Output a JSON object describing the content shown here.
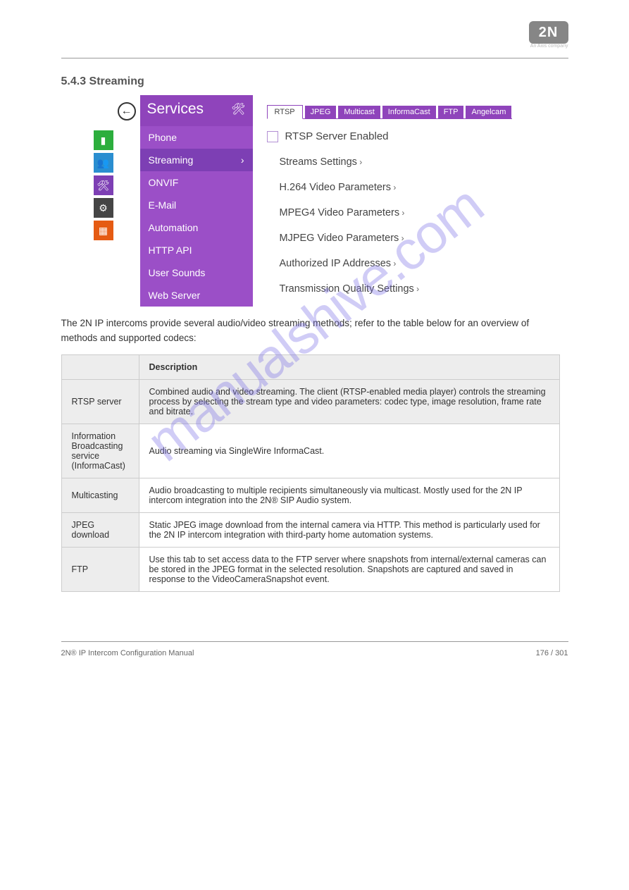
{
  "brand": {
    "logo_text": "2N",
    "sub_text": "An Axis company"
  },
  "section_title": "5.4.3 Streaming",
  "watermark": "manualshive.com",
  "ui": {
    "side_title": "Services",
    "gear_icon_name": "tools-icon",
    "side_icons": [
      {
        "name": "status-icon",
        "glyph": "▮",
        "cls": "ic-green"
      },
      {
        "name": "directory-icon",
        "glyph": "👥",
        "cls": "ic-blue"
      },
      {
        "name": "services-icon",
        "glyph": "🛠",
        "cls": "ic-purple"
      },
      {
        "name": "hardware-icon",
        "glyph": "⚙",
        "cls": "ic-dark"
      },
      {
        "name": "system-icon",
        "glyph": "▦",
        "cls": "ic-orange"
      }
    ],
    "side_items": [
      {
        "label": "Phone",
        "active": false
      },
      {
        "label": "Streaming",
        "active": true
      },
      {
        "label": "ONVIF",
        "active": false
      },
      {
        "label": "E-Mail",
        "active": false
      },
      {
        "label": "Automation",
        "active": false
      },
      {
        "label": "HTTP API",
        "active": false
      },
      {
        "label": "User Sounds",
        "active": false
      },
      {
        "label": "Web Server",
        "active": false
      }
    ],
    "tabs": [
      {
        "label": "RTSP",
        "active": true
      },
      {
        "label": "JPEG",
        "active": false
      },
      {
        "label": "Multicast",
        "active": false
      },
      {
        "label": "InformaCast",
        "active": false
      },
      {
        "label": "FTP",
        "active": false
      },
      {
        "label": "Angelcam",
        "active": false
      }
    ],
    "checkbox_label": "RTSP Server Enabled",
    "sub_links": [
      "Streams Settings",
      "H.264 Video Parameters",
      "MPEG4 Video Parameters",
      "MJPEG Video Parameters",
      "Authorized IP Addresses",
      "Transmission Quality Settings"
    ]
  },
  "intro": "The 2N IP intercoms provide several audio/video streaming methods; refer to the table below for an overview of methods and supported codecs:",
  "table": {
    "headers": [
      "",
      "Description"
    ],
    "rows": [
      [
        "RTSP server",
        "Combined audio and video streaming. The client (RTSP-enabled media player) controls the streaming process by selecting the stream type and video parameters: codec type, image resolution, frame rate and bitrate."
      ],
      [
        "Information Broadcasting service (InformaCast)",
        "Audio streaming via SingleWire InformaCast."
      ],
      [
        "Multicasting",
        "Audio broadcasting to multiple recipients simultaneously via multicast. Mostly used for the 2N IP intercom integration into the 2N® SIP Audio system."
      ],
      [
        "JPEG download",
        "Static JPEG image download from the internal camera via HTTP. This method is particularly used for the 2N IP intercom integration with third-party home automation systems."
      ],
      [
        "FTP",
        "Use this tab to set access data to the FTP server where snapshots from internal/external cameras can be stored in the JPEG format in the selected resolution. Snapshots are captured and saved in response to the VideoCameraSnapshot event."
      ]
    ]
  },
  "footer": {
    "left": "2N® IP Intercom Configuration Manual",
    "right": "176 / 301"
  }
}
